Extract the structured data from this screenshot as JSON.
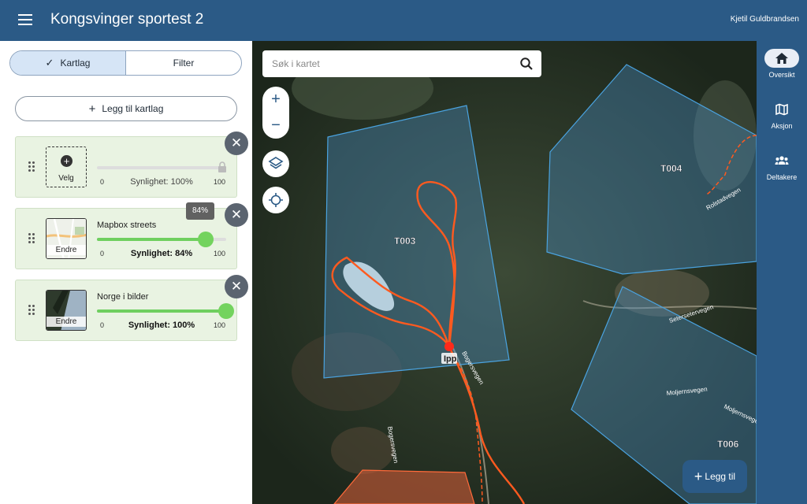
{
  "header": {
    "title": "Kongsvinger sportest 2",
    "user": "Kjetil Guldbrandsen"
  },
  "panel": {
    "tabs": [
      {
        "label": "Kartlag",
        "active": true
      },
      {
        "label": "Filter",
        "active": false
      }
    ],
    "add_layer_label": "Legg til kartlag",
    "layers": [
      {
        "thumb_label": "Velg",
        "name": "",
        "min": "0",
        "max": "100",
        "visibility": "Synlighet: 100%",
        "opacity": 1.0,
        "locked": true
      },
      {
        "thumb_label": "Endre",
        "name": "Mapbox streets",
        "min": "0",
        "max": "100",
        "visibility": "Synlighet: 84%",
        "opacity": 0.84,
        "tooltip": "84%"
      },
      {
        "thumb_label": "Endre",
        "name": "Norge i bilder",
        "min": "0",
        "max": "100",
        "visibility": "Synlighet: 100%",
        "opacity": 1.0
      }
    ]
  },
  "map": {
    "search_placeholder": "Søk i kartet",
    "zoom_in": "+",
    "zoom_out": "−",
    "labels": {
      "t003": "T003",
      "t004": "T004",
      "t006": "T006",
      "ipp": "Ipp",
      "road1": "Rolstadvegen",
      "road2": "Setersetervegen",
      "road3": "Moljernsvegen",
      "road4": "Moljernsvegen",
      "road5": "Bogersvegen",
      "road6": "Bogersvegen"
    },
    "colors": {
      "polygon": "#4aa3e0",
      "track": "#ff5a1f",
      "search_area": "#e0603a"
    }
  },
  "fab_label": "Legg til",
  "rail": [
    {
      "label": "Oversikt",
      "icon": "home-icon",
      "active": true
    },
    {
      "label": "Aksjon",
      "icon": "map-icon",
      "active": false
    },
    {
      "label": "Deltakere",
      "icon": "people-icon",
      "active": false
    }
  ]
}
